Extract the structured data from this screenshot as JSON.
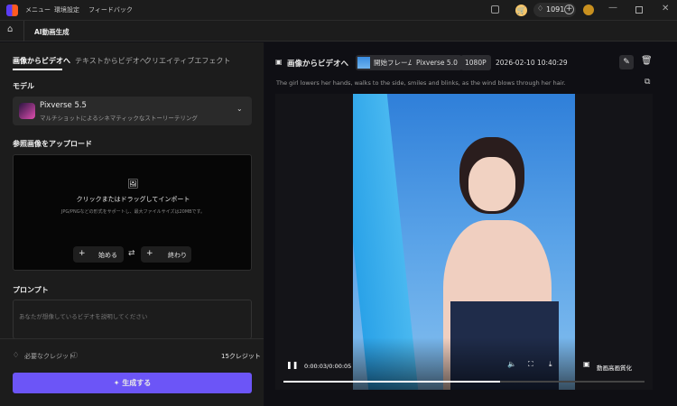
{
  "titlebar": {
    "menu": [
      "メニュー",
      "環境設定",
      "フィードバック"
    ],
    "credits": "1091"
  },
  "nav": {
    "title": "AI動画生成"
  },
  "tabs": [
    "画像からビデオへ",
    "テキストからビデオへ",
    "クリエイティブエフェクト"
  ],
  "model": {
    "label": "モデル",
    "name": "Pixverse 5.5",
    "desc": "マルチショットによるシネマティックなストーリーテリング"
  },
  "upload": {
    "label": "参照画像をアップロード",
    "title": "クリックまたはドラッグしてインポート",
    "hint": "JPG/PNGなどの形式をサポートし、最大ファイルサイズは20MBです。",
    "start": "始める",
    "end": "終わり"
  },
  "prompt": {
    "label": "プロンプト",
    "placeholder": "あなたが想像しているビデオを説明してください"
  },
  "footer": {
    "credits_label": "必要なクレジット",
    "credits_value": "15クレジット",
    "generate": "生成する"
  },
  "result": {
    "title": "画像からビデオへ",
    "frame": "開始フレーム",
    "model": "Pixverse 5.0",
    "resolution": "1080P",
    "timestamp": "2026-02-10 10:40:29",
    "prompt": "The girl lowers her hands, walks to the side, smiles and blinks, as the wind blows through her hair."
  },
  "player": {
    "time": "0:00:03/0:00:05",
    "progress": 0.6,
    "enhance": "動画高画質化"
  },
  "colors": {
    "accent": "#6c55f7"
  }
}
